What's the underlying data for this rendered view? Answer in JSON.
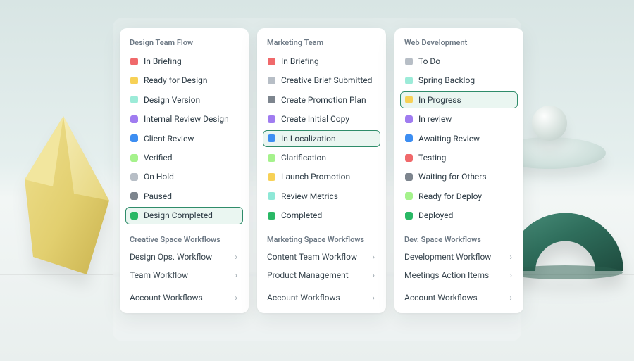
{
  "colors": {
    "red": "#f0696b",
    "yellow": "#f7d156",
    "mint": "#9cebd8",
    "purple": "#a07cf0",
    "blue": "#3d8ef2",
    "lime": "#a5f28c",
    "gray": "#b7bec6",
    "darkgray": "#7d858e",
    "green": "#29b865",
    "teal": "#8ee8d7"
  },
  "columns": [
    {
      "title": "Design Team Flow",
      "statuses": [
        {
          "label": "In Briefing",
          "color": "red"
        },
        {
          "label": "Ready for Design",
          "color": "yellow"
        },
        {
          "label": "Design Version",
          "color": "mint"
        },
        {
          "label": "Internal Review Design",
          "color": "purple"
        },
        {
          "label": "Client Review",
          "color": "blue"
        },
        {
          "label": "Verified",
          "color": "lime"
        },
        {
          "label": "On Hold",
          "color": "gray"
        },
        {
          "label": "Paused",
          "color": "darkgray"
        },
        {
          "label": "Design Completed",
          "color": "green",
          "selected": true
        }
      ],
      "space_title": "Creative Space Workflows",
      "space_links": [
        {
          "label": "Design Ops. Workflow"
        },
        {
          "label": "Team Workflow"
        }
      ],
      "account_link": "Account Workflows"
    },
    {
      "title": "Marketing Team",
      "statuses": [
        {
          "label": "In Briefing",
          "color": "red"
        },
        {
          "label": "Creative Brief Submitted",
          "color": "gray"
        },
        {
          "label": "Create Promotion Plan",
          "color": "darkgray"
        },
        {
          "label": "Create Initial Copy",
          "color": "purple"
        },
        {
          "label": "In Localization",
          "color": "blue",
          "selected": true
        },
        {
          "label": "Clarification",
          "color": "lime"
        },
        {
          "label": "Launch Promotion",
          "color": "yellow"
        },
        {
          "label": "Review Metrics",
          "color": "teal"
        },
        {
          "label": "Completed",
          "color": "green"
        }
      ],
      "space_title": "Marketing Space Workflows",
      "space_links": [
        {
          "label": "Content Team Workflow"
        },
        {
          "label": "Product Management"
        }
      ],
      "account_link": "Account Workflows"
    },
    {
      "title": "Web Development",
      "statuses": [
        {
          "label": "To Do",
          "color": "gray"
        },
        {
          "label": "Spring Backlog",
          "color": "mint"
        },
        {
          "label": "In Progress",
          "color": "yellow",
          "selected": true
        },
        {
          "label": "In review",
          "color": "purple"
        },
        {
          "label": "Awaiting Review",
          "color": "blue"
        },
        {
          "label": "Testing",
          "color": "red"
        },
        {
          "label": "Waiting for Others",
          "color": "darkgray"
        },
        {
          "label": "Ready for Deploy",
          "color": "lime"
        },
        {
          "label": "Deployed",
          "color": "green"
        }
      ],
      "space_title": "Dev. Space Workflows",
      "space_links": [
        {
          "label": "Development Workflow"
        },
        {
          "label": "Meetings Action Items"
        }
      ],
      "account_link": "Account Workflows"
    }
  ]
}
